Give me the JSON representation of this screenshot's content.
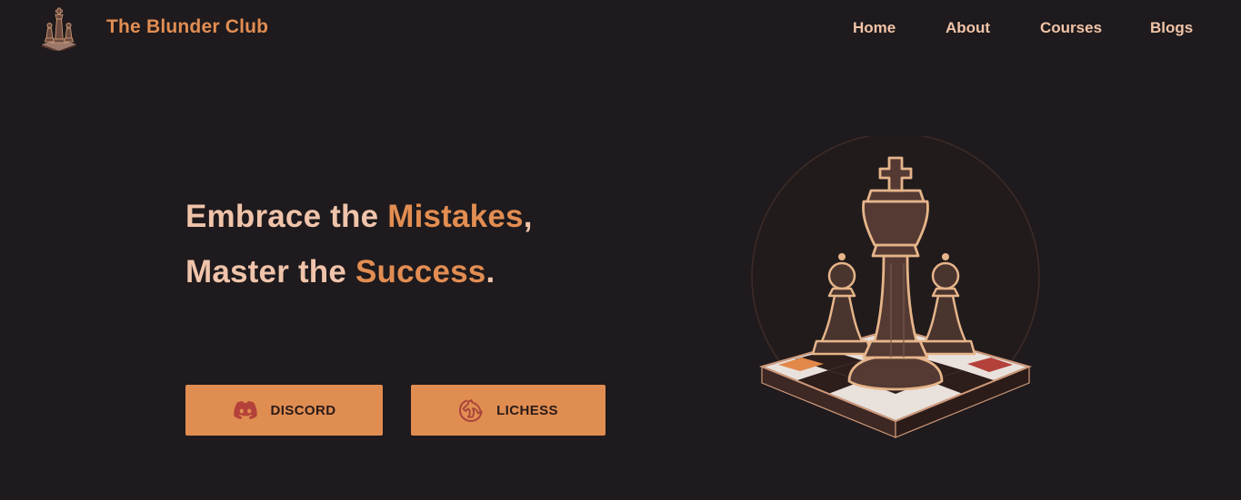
{
  "header": {
    "brand": "The Blunder Club",
    "logo_icon": "chess-pieces-logo-icon",
    "nav": [
      {
        "label": "Home"
      },
      {
        "label": "About"
      },
      {
        "label": "Courses"
      },
      {
        "label": "Blogs"
      }
    ]
  },
  "hero": {
    "line1": {
      "before": "Embrace the ",
      "accent": "Mistakes",
      "after": ","
    },
    "line2": {
      "before": "Master the ",
      "accent": "Success",
      "after": "."
    },
    "buttons": [
      {
        "label": "DISCORD",
        "icon": "discord-icon"
      },
      {
        "label": "LICHESS",
        "icon": "lichess-knight-icon"
      }
    ],
    "illustration": "chess-king-and-pawns-on-board-illustration"
  },
  "colors": {
    "background": "#1e1a1d",
    "accent": "#e28d52",
    "text_light": "#f0c4aa",
    "button_bg": "#e08d51",
    "button_text": "#2a1b18"
  }
}
